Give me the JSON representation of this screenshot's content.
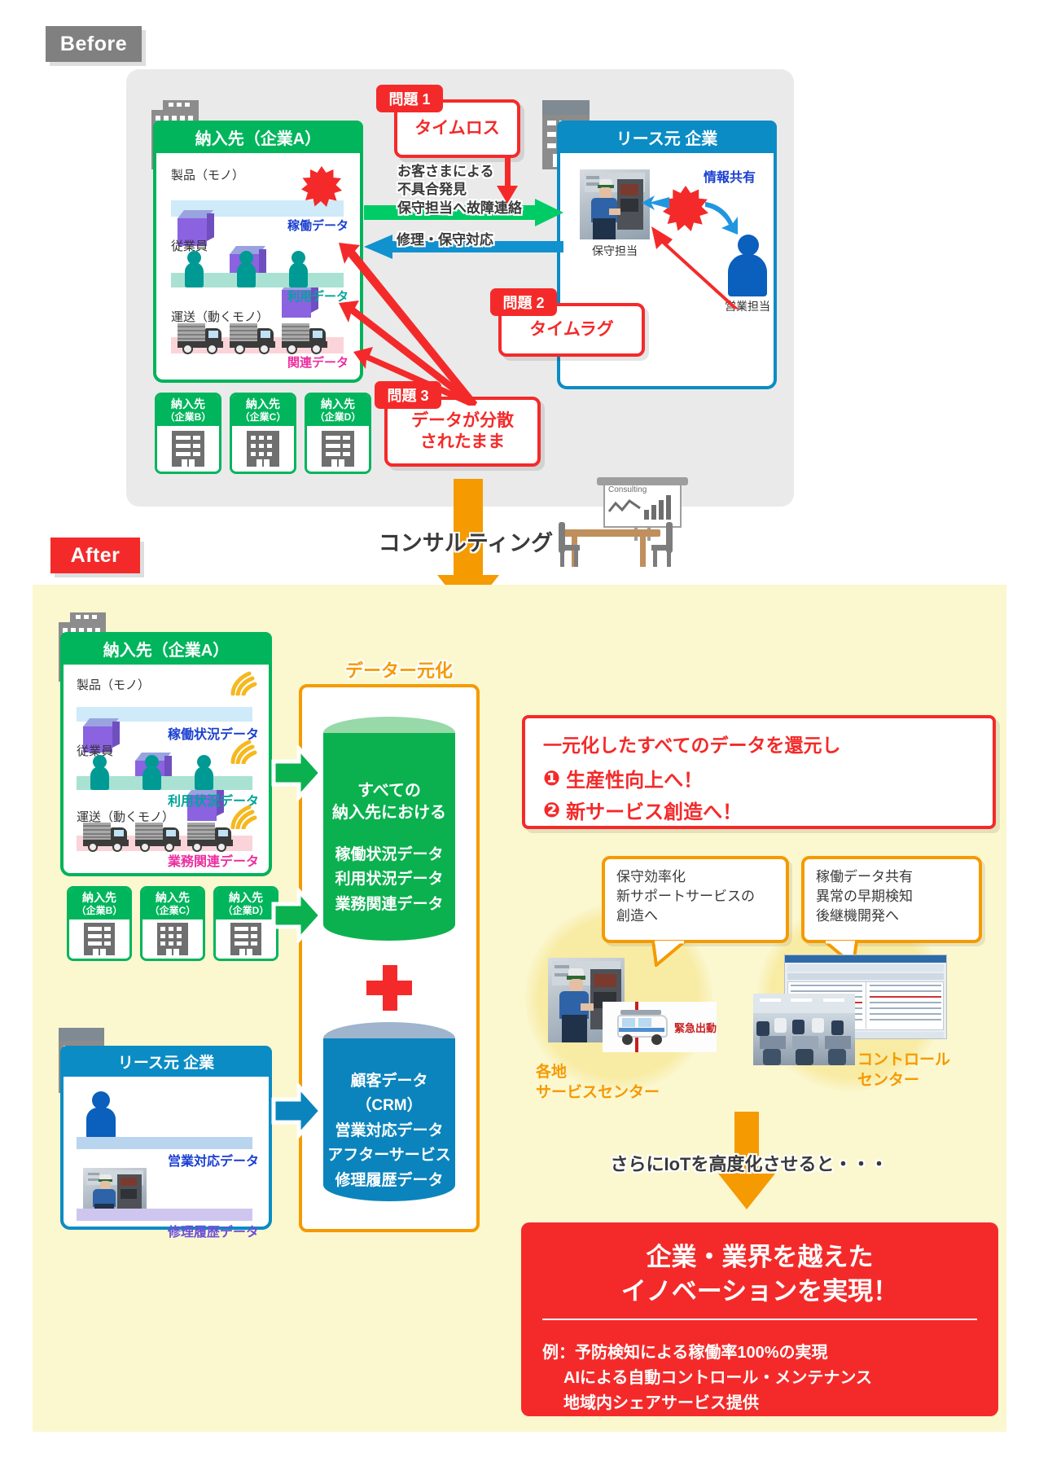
{
  "sections": {
    "before_label": "Before",
    "after_label": "After",
    "consulting_label": "コンサルティング",
    "whiteboard_label": "Consulting"
  },
  "before": {
    "customer": {
      "header": "納入先（企業A）",
      "rows": [
        {
          "label": "製品（モノ）",
          "data_label": "稼働データ",
          "data_color": "#1a3fd0"
        },
        {
          "label": "従業員",
          "data_label": "利用データ",
          "data_color": "#00a59a"
        },
        {
          "label": "運送（動くモノ）",
          "data_label": "関連データ",
          "data_color": "#ec2ea0"
        }
      ]
    },
    "chips": [
      {
        "line1": "納入先",
        "line2": "（企業B）"
      },
      {
        "line1": "納入先",
        "line2": "（企業C）"
      },
      {
        "line1": "納入先",
        "line2": "（企業D）"
      }
    ],
    "lessor": {
      "header": "リース元 企業",
      "maintenance_caption": "保守担当",
      "sales_caption": "営業担当",
      "share_label": "情報共有"
    },
    "flow_forward": "お客さまによる\n不具合発見\n保守担当へ故障連絡",
    "flow_forward_lines": [
      "お客さまによる",
      "不具合発見",
      "保守担当へ故障連絡"
    ],
    "flow_back": "修理・保守対応",
    "problems": [
      {
        "tag": "問題 1",
        "text": "タイムロス"
      },
      {
        "tag": "問題 2",
        "text": "タイムラグ"
      },
      {
        "tag": "問題 3",
        "text": "データが分散\nされたまま",
        "lines": [
          "データが分散",
          "されたまま"
        ]
      }
    ]
  },
  "after": {
    "customer": {
      "header": "納入先（企業A）",
      "rows": [
        {
          "label": "製品（モノ）",
          "data_label": "稼働状況データ",
          "data_color": "#1a3fd0"
        },
        {
          "label": "従業員",
          "data_label": "利用状況データ",
          "data_color": "#00a59a"
        },
        {
          "label": "運送（動くモノ）",
          "data_label": "業務関連データ",
          "data_color": "#ec2ea0"
        }
      ]
    },
    "chips": [
      {
        "line1": "納入先",
        "line2": "（企業B）"
      },
      {
        "line1": "納入先",
        "line2": "（企業C）"
      },
      {
        "line1": "納入先",
        "line2": "（企業D）"
      }
    ],
    "lessor": {
      "header": "リース元 企業",
      "rows": [
        {
          "data_label": "営業対応データ",
          "data_color": "#1a3fd0"
        },
        {
          "data_label": "修理履歴データ",
          "data_color": "#6b4fd8"
        }
      ]
    },
    "unify_title": "データー元化",
    "cylinder_green": {
      "head_lines": [
        "すべての",
        "納入先における"
      ],
      "items": [
        "稼働状況データ",
        "利用状況データ",
        "業務関連データ"
      ]
    },
    "plus_symbol": "+",
    "cylinder_blue": {
      "items": [
        "顧客データ（CRM）",
        "営業対応データ",
        "アフターサービス",
        "修理履歴データ"
      ]
    },
    "callout": {
      "headline": "一元化したすべてのデータを還元し",
      "points": [
        {
          "num": "❶",
          "text": "生産性向上へ！"
        },
        {
          "num": "❷",
          "text": "新サービス創造へ！"
        }
      ]
    },
    "notes": [
      {
        "lines": [
          "保守効率化",
          "新サポートサービスの",
          "創造へ"
        ]
      },
      {
        "lines": [
          "稼働データ共有",
          "異常の早期検知",
          "後継機開発へ"
        ]
      }
    ],
    "photo_captions": [
      {
        "lines": [
          "各地",
          "サービスセンター"
        ]
      },
      {
        "lines": [
          "コントロール",
          "センター"
        ]
      }
    ],
    "emergency_label": "緊急出動",
    "escalation_label": "さらにIoTを高度化させると・・・",
    "final": {
      "title_lines": [
        "企業・業界を越えた",
        "イノベーションを実現！"
      ],
      "example_lines": [
        "例：予防検知による稼働率100%の実現",
        "AIによる自動コントロール・メンテナンス",
        "地域内シェアサービス提供"
      ]
    }
  },
  "colors": {
    "green": "#00b55c",
    "blue": "#0b8cc4",
    "red": "#f42a2a",
    "orange": "#f59a00",
    "grey": "#808080",
    "yellow_bg": "#fbf7cf"
  }
}
